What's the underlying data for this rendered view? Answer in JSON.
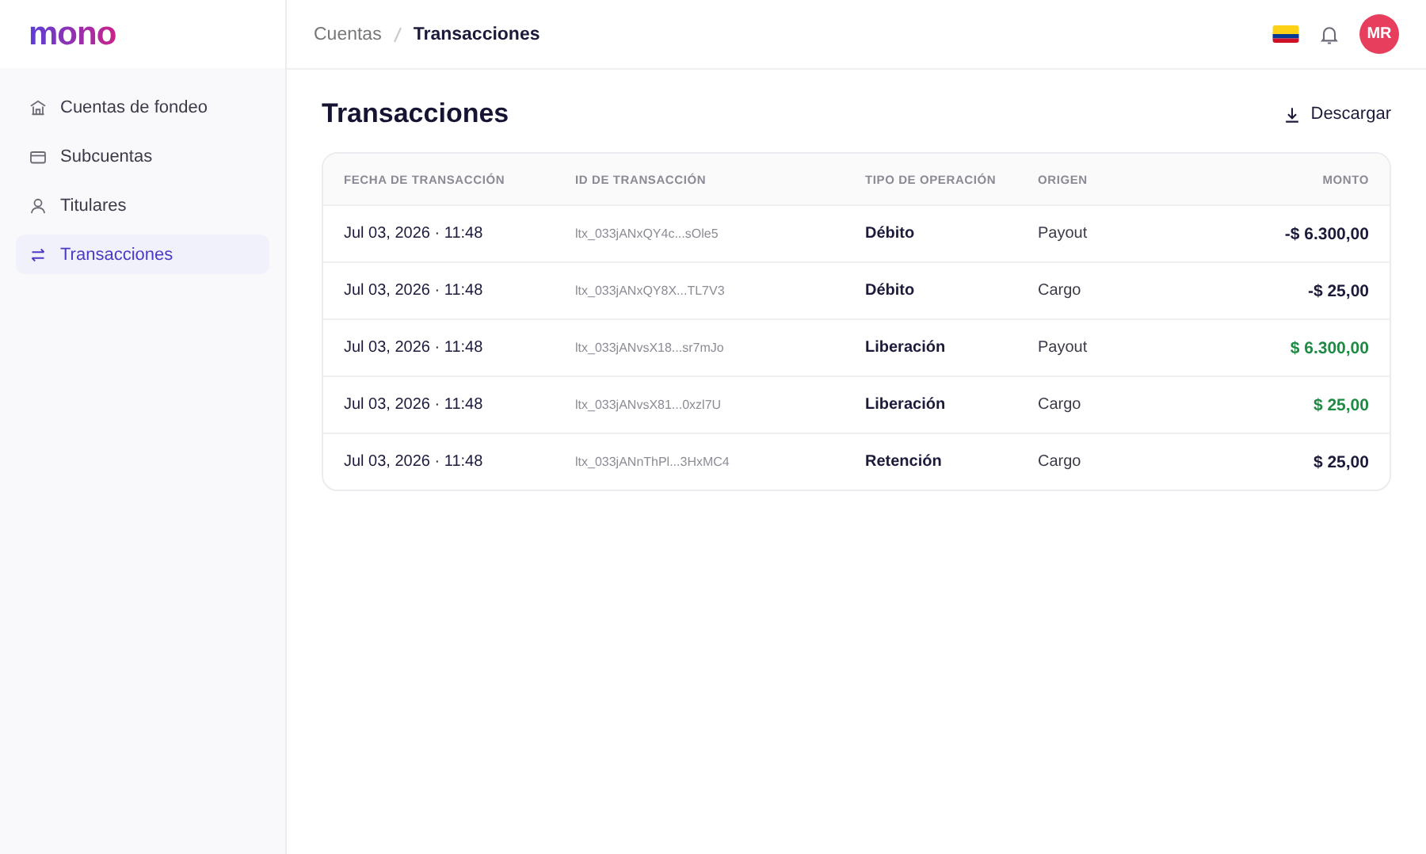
{
  "logo": "mono",
  "sidebar": {
    "items": [
      {
        "label": "Cuentas de fondeo",
        "selected": false
      },
      {
        "label": "Subcuentas",
        "selected": false
      },
      {
        "label": "Titulares",
        "selected": false
      },
      {
        "label": "Transacciones",
        "selected": true
      }
    ]
  },
  "breadcrumb": [
    "Cuentas",
    "Transacciones"
  ],
  "user": {
    "initials": "MR"
  },
  "page": {
    "title": "Transacciones",
    "download": "Descargar"
  },
  "table": {
    "columns": [
      "FECHA DE TRANSACCIÓN",
      "ID DE TRANSACCIÓN",
      "TIPO DE OPERACIÓN",
      "ORIGEN",
      "MONTO"
    ],
    "rows": [
      {
        "date": "Jul 03, 2026 · 11:48",
        "id": "ltx_033jANxQY4c...sOle5",
        "type": "Débito",
        "origin": "Payout",
        "amount": "-$ 6.300,00",
        "credit": false
      },
      {
        "date": "Jul 03, 2026 · 11:48",
        "id": "ltx_033jANxQY8X...TL7V3",
        "type": "Débito",
        "origin": "Cargo",
        "amount": "-$ 25,00",
        "credit": false
      },
      {
        "date": "Jul 03, 2026 · 11:48",
        "id": "ltx_033jANvsX18...sr7mJo",
        "type": "Liberación",
        "origin": "Payout",
        "amount": "$ 6.300,00",
        "credit": true
      },
      {
        "date": "Jul 03, 2026 · 11:48",
        "id": "ltx_033jANvsX81...0xzl7U",
        "type": "Liberación",
        "origin": "Cargo",
        "amount": "$ 25,00",
        "credit": true
      },
      {
        "date": "Jul 03, 2026 · 11:48",
        "id": "ltx_033jANnThPl...3HxMC4",
        "type": "Retención",
        "origin": "Cargo",
        "amount": "$ 25,00",
        "credit": false
      }
    ]
  }
}
